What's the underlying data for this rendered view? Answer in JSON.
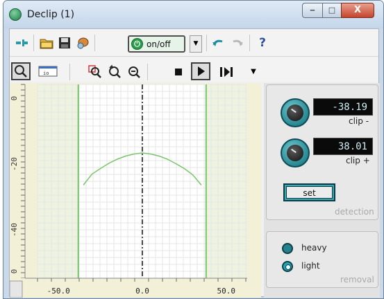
{
  "window": {
    "title": "Declip (1)",
    "minimize_glyph": "‒",
    "maximize_glyph": "□",
    "close_glyph": "X"
  },
  "toolbar1": {
    "onoff_label": "on/off",
    "help_glyph": "?"
  },
  "toolbar2": {
    "time_display_label": "io"
  },
  "plot": {
    "x_tick_labels": [
      "-50.0",
      "0.0",
      "50.0"
    ],
    "y_tick_labels": [
      "0",
      "-20",
      "-40",
      "0"
    ],
    "colors": {
      "background": "#ffffff",
      "margin": "#f3f0d8",
      "curve": "#79c46a",
      "grid": "#e6e6e6"
    }
  },
  "detection": {
    "clip_minus_value": "-38.19",
    "clip_minus_label": "clip -",
    "clip_plus_value": "38.01",
    "clip_plus_label": "clip +",
    "set_label": "set",
    "section_label": "detection"
  },
  "removal": {
    "options": [
      {
        "label": "heavy",
        "selected": false
      },
      {
        "label": "light",
        "selected": true
      }
    ],
    "section_label": "removal"
  },
  "chart_data": {
    "type": "line",
    "x_tick_labels": [
      "-50.0",
      "0.0",
      "50.0"
    ],
    "y_tick_labels": [
      "0",
      "-20",
      "-40",
      "0"
    ],
    "xlim": [
      -62.5,
      62.5
    ],
    "ylim": [
      -54,
      2
    ],
    "clip_lines_x": [
      -38.19,
      38.01
    ],
    "center_line_x": 0,
    "series": [
      {
        "x": [
          -35,
          -30,
          -25,
          -20,
          -15,
          -10,
          -5,
          0,
          5,
          10,
          15,
          20,
          25,
          30,
          35
        ],
        "values": [
          -27,
          -23.9,
          -22.3,
          -20.8,
          -19.6,
          -18.7,
          -18.1,
          -17.8,
          -18.1,
          -18.7,
          -19.6,
          -20.9,
          -22.3,
          -24.1,
          -27
        ]
      }
    ],
    "grid": true
  }
}
